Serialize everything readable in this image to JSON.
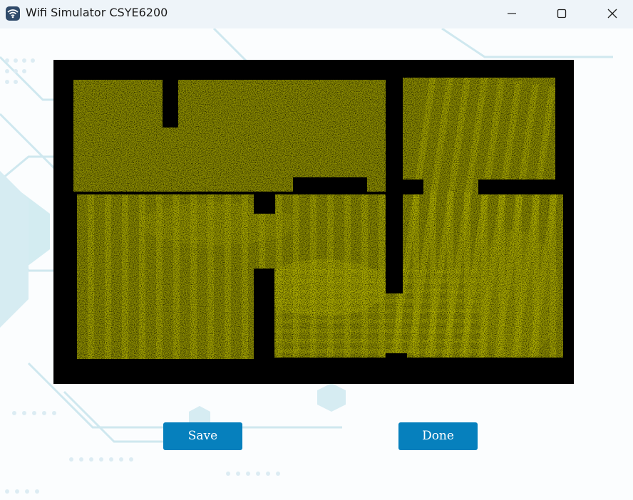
{
  "window": {
    "title": "Wifi Simulator CSYE6200",
    "app_icon": "wifi-icon",
    "controls": [
      "minimize-icon",
      "maximize-icon",
      "close-icon"
    ]
  },
  "heatmap": {
    "signal_color": "#8a8a00",
    "wall_color": "#000000"
  },
  "actions": {
    "save_label": "Save",
    "done_label": "Done"
  },
  "colors": {
    "titlebar": "#eef4f9",
    "button": "#0680bd",
    "button_text": "#ffffff"
  }
}
